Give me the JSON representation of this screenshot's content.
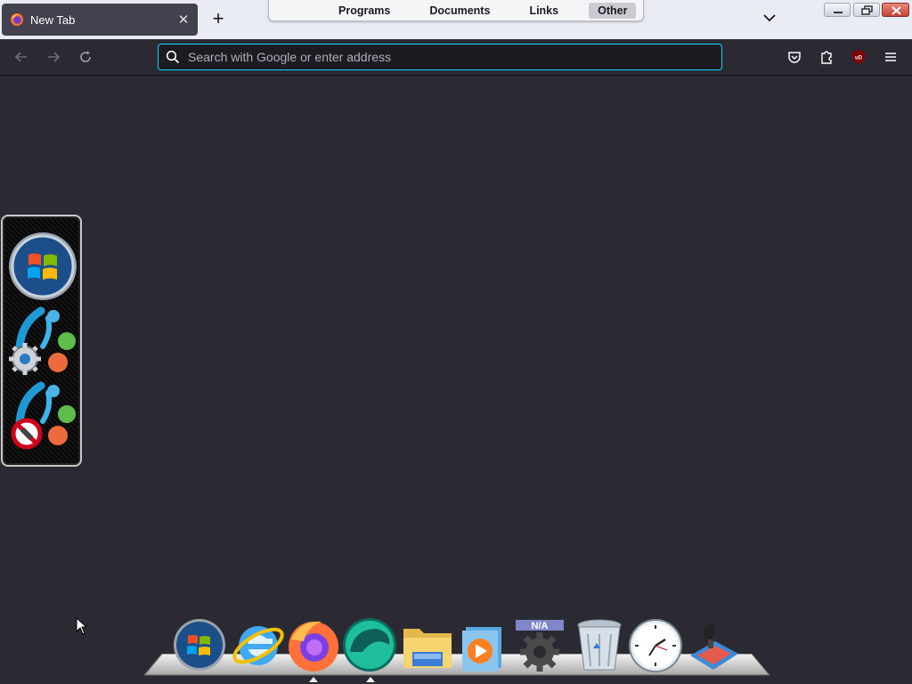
{
  "browser": {
    "tab": {
      "title": "New Tab",
      "favicon": "firefox-icon",
      "close_icon": "close-icon"
    },
    "new_tab_icon": "plus-icon",
    "list_all_tabs_icon": "chevron-down-icon",
    "bookmarks": [
      {
        "label": "Programs",
        "active": false
      },
      {
        "label": "Documents",
        "active": false
      },
      {
        "label": "Links",
        "active": false
      },
      {
        "label": "Other",
        "active": true
      }
    ],
    "window_controls": [
      "minimize-icon",
      "restore-icon",
      "close-icon"
    ],
    "toolbar": {
      "back_icon": "arrow-left-icon",
      "forward_icon": "arrow-right-icon",
      "reload_icon": "reload-icon",
      "search_placeholder": "Search with Google or enter address",
      "pocket_icon": "pocket-icon",
      "extensions_icon": "puzzle-icon",
      "ublock_label": "uD",
      "menu_icon": "hamburger-menu-icon"
    }
  },
  "side_gadget": {
    "items": [
      "windows-start-icon",
      "settings-icon",
      "disable-icon"
    ]
  },
  "dock": {
    "items": [
      "windows-start-icon",
      "internet-explorer-icon",
      "firefox-icon",
      "browser-icon",
      "folder-icon",
      "media-player-icon",
      "na-gear-icon",
      "recycle-bin-icon",
      "clock-icon",
      "tools-icon"
    ],
    "na_label": "N/A"
  },
  "colors": {
    "content_bg": "#2b2a33",
    "tabstrip_bg": "#e9edf3",
    "urlbar_focus": "#00ddff"
  }
}
